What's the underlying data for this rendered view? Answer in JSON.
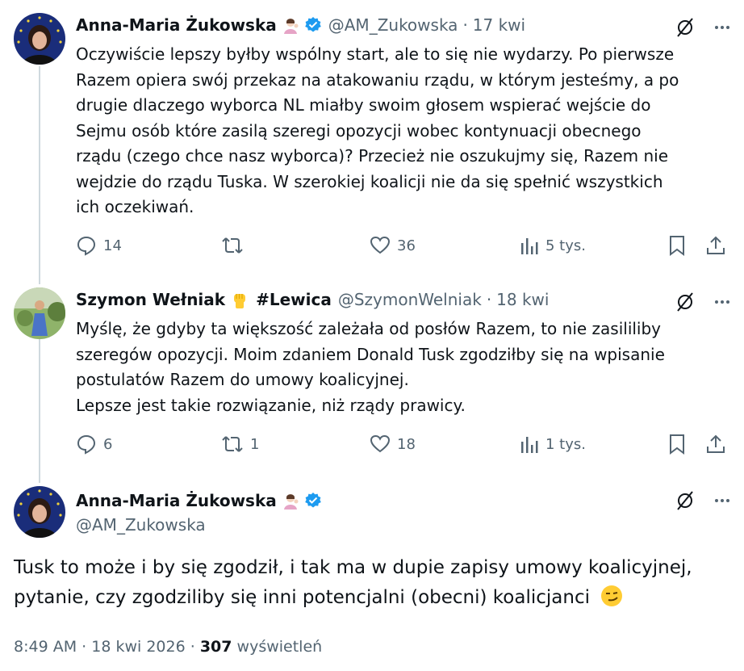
{
  "tweets": [
    {
      "name": "Anna-Maria Żukowska",
      "emoji": "person-tipping-hand-emoji",
      "handle": "@AM_Zukowska",
      "date": "17 kwi",
      "text": [
        "Oczywiście lepszy byłby wspólny start, ale to się nie wydarzy. Po pierwsze",
        "Razem opiera swój przekaz na atakowaniu rządu, w którym jesteśmy, a po",
        "drugie dlaczego wyborca NL miałby swoim głosem wspierać wejście do",
        "Sejmu osób które zasilą szeregi opozycji wobec kontynuacji obecnego",
        "rządu (czego chce nasz wyborca)? Przecież nie oszukujmy się, Razem nie",
        "wejdzie do rządu Tuska. W szerokiej koalicji nie da się spełnić wszystkich",
        "ich oczekiwań."
      ],
      "replies": "14",
      "reposts": "",
      "likes": "36",
      "views": "5 tys."
    },
    {
      "name": "Szymon Wełniak",
      "emoji": "raised-fist-emoji",
      "hashtag": "#Lewica",
      "handle": "@SzymonWelniak",
      "date": "18 kwi",
      "text": [
        "Myślę, że gdyby ta większość zależała od posłów Razem, to nie zasililiby",
        "szeregów opozycji. Moim zdaniem Donald Tusk zgodziłby się na wpisanie",
        "postulatów Razem do umowy koalicyjnej.",
        "Lepsze jest takie rozwiązanie, niż rządy prawicy."
      ],
      "replies": "6",
      "reposts": "1",
      "likes": "18",
      "views": "1 tys."
    }
  ],
  "main_tweet": {
    "name": "Anna-Maria Żukowska",
    "handle": "@AM_Zukowska",
    "text": [
      "Tusk to może i by się zgodził, i tak ma w dupie zapisy umowy koalicyjnej,",
      "pytanie, czy zgodziliby się inni potencjalni (obecni) koalicjanci"
    ],
    "emoji": "smirking-face-emoji",
    "time": "8:49 AM",
    "date": "18 kwi 2026",
    "views_count": "307",
    "views_label": "wyświetleń"
  },
  "colors": {
    "verified": "#1d9bf0",
    "text": "#0f1419",
    "secondary": "#536471",
    "thread_line": "#cfd9de"
  }
}
